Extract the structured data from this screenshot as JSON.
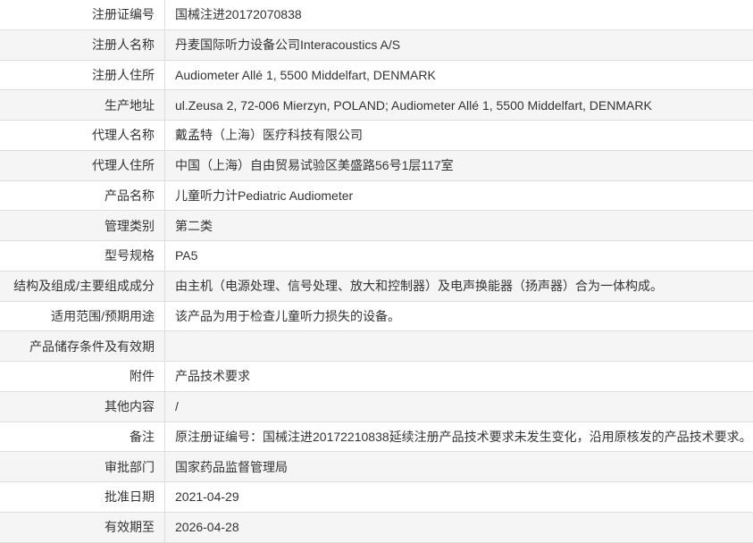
{
  "colors": {
    "text": "#333333",
    "row_alt_bg": "#f5f5f5",
    "border": "#dddddd",
    "page_bg": "#ffffff"
  },
  "rows": [
    {
      "label": "注册证编号",
      "value": "国械注进20172070838"
    },
    {
      "label": "注册人名称",
      "value": "丹麦国际听力设备公司Interacoustics A/S"
    },
    {
      "label": "注册人住所",
      "value": "Audiometer Allé 1, 5500 Middelfart, DENMARK"
    },
    {
      "label": "生产地址",
      "value": "ul.Zeusa 2, 72-006 Mierzyn, POLAND; Audiometer Allé 1, 5500 Middelfart, DENMARK"
    },
    {
      "label": "代理人名称",
      "value": "戴孟特（上海）医疗科技有限公司"
    },
    {
      "label": "代理人住所",
      "value": "中国（上海）自由贸易试验区美盛路56号1层117室"
    },
    {
      "label": "产品名称",
      "value": "儿童听力计Pediatric Audiometer"
    },
    {
      "label": "管理类别",
      "value": "第二类"
    },
    {
      "label": "型号规格",
      "value": "PA5"
    },
    {
      "label": "结构及组成/主要组成成分",
      "value": "由主机（电源处理、信号处理、放大和控制器）及电声换能器（扬声器）合为一体构成。"
    },
    {
      "label": "适用范围/预期用途",
      "value": "该产品为用于检查儿童听力损失的设备。"
    },
    {
      "label": "产品储存条件及有效期",
      "value": ""
    },
    {
      "label": "附件",
      "value": "产品技术要求"
    },
    {
      "label": "其他内容",
      "value": "/"
    },
    {
      "label": "备注",
      "value": "原注册证编号：国械注进20172210838延续注册产品技术要求未发生变化，沿用原核发的产品技术要求。"
    },
    {
      "label": "审批部门",
      "value": "国家药品监督管理局"
    },
    {
      "label": "批准日期",
      "value": "2021-04-29"
    },
    {
      "label": "有效期至",
      "value": "2026-04-28"
    }
  ]
}
